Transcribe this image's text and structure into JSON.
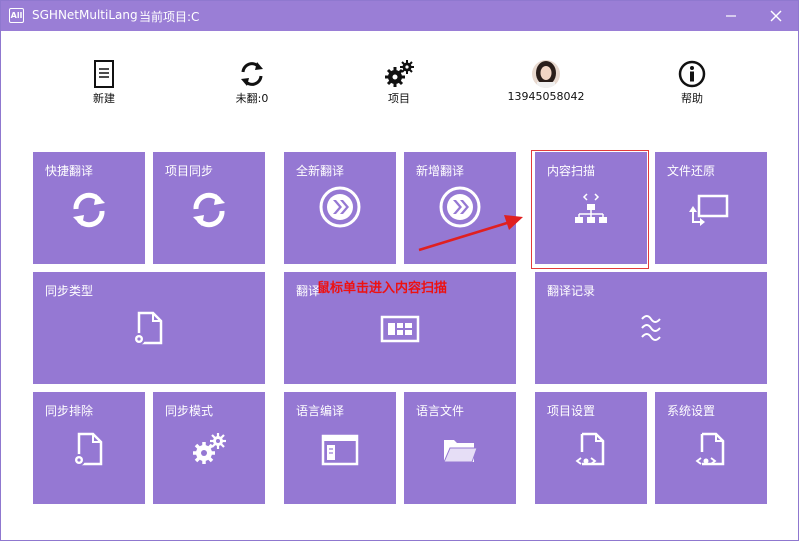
{
  "window": {
    "app_title": "SGHNetMultiLang",
    "project_label": "当前项目:C",
    "app_icon_text": "All"
  },
  "toolbar": {
    "new_label": "新建",
    "untranslated_label": "未翻:0",
    "project_label": "项目",
    "user_phone": "13945058042",
    "help_label": "帮助"
  },
  "tiles": {
    "quick_translate": "快捷翻译",
    "project_sync": "项目同步",
    "full_translate": "全新翻译",
    "incremental_translate": "新增翻译",
    "content_scan": "内容扫描",
    "file_restore": "文件还原",
    "sync_type": "同步类型",
    "translate_partial": "翻译",
    "translate_records": "翻译记录",
    "sync_exclude": "同步排除",
    "sync_mode": "同步模式",
    "language_edit": "语言编译",
    "language_files": "语言文件",
    "project_settings": "项目设置",
    "system_settings": "系统设置"
  },
  "annotation": {
    "text": "鼠标单击进入内容扫描"
  },
  "colors": {
    "tile": "#9578d3",
    "titlebar": "#9a7ed6",
    "annotation": "#ee1111"
  }
}
